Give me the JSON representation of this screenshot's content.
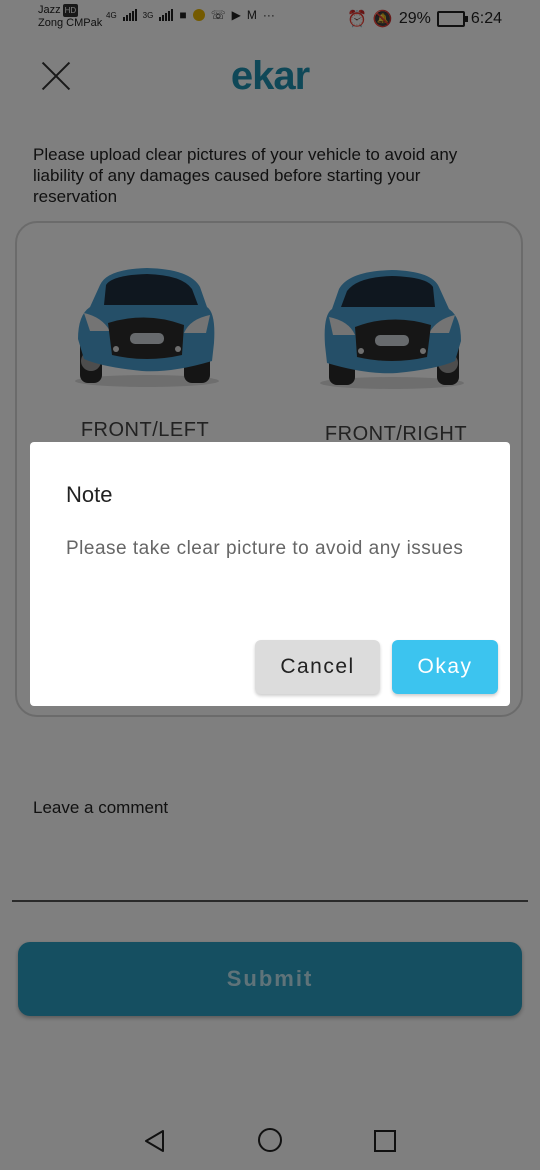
{
  "status_bar": {
    "carrier_1": "Jazz",
    "carrier_1_badge": "HD",
    "carrier_2": "Zong CMPak",
    "network_1": "4G",
    "network_2": "3G",
    "more": "···",
    "battery": "29%",
    "time": "6:24"
  },
  "header": {
    "logo": "ekar"
  },
  "instructions": "Please upload clear pictures of your vehicle to avoid any liability of any damages caused before starting your reservation",
  "photos": [
    {
      "label": "FRONT/LEFT"
    },
    {
      "label": "FRONT/RIGHT"
    }
  ],
  "comment": {
    "label": "Leave a comment"
  },
  "submit_label": "Submit",
  "dialog": {
    "title": "Note",
    "message": "Please take clear picture to avoid any issues",
    "cancel_label": "Cancel",
    "okay_label": "Okay"
  },
  "colors": {
    "brand": "#1e91b1",
    "submit": "#2b9ec2",
    "okay": "#3cc4ef",
    "car_body": "#4b9fd0"
  }
}
